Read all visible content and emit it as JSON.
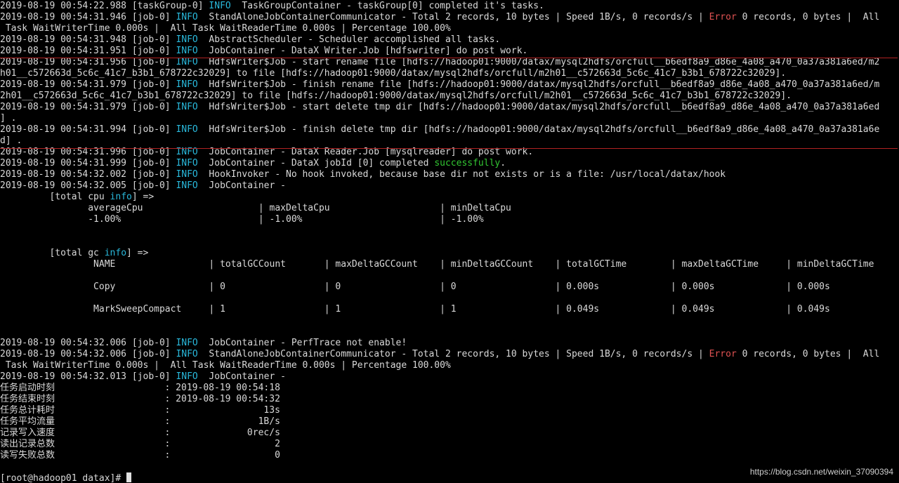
{
  "terminal": {
    "lines": [
      [
        {
          "t": "2019-08-19 00:54:22.988 [taskGroup-0] "
        },
        {
          "t": "INFO",
          "c": "info"
        },
        {
          "t": "  TaskGroupContainer - taskGroup[0] completed it's tasks."
        }
      ],
      [
        {
          "t": "2019-08-19 00:54:31.946 [job-0] "
        },
        {
          "t": "INFO",
          "c": "info"
        },
        {
          "t": "  StandAloneJobContainerCommunicator - Total 2 records, 10 bytes | Speed 1B/s, 0 records/s | "
        },
        {
          "t": "Error",
          "c": "error"
        },
        {
          "t": " 0 records, 0 bytes |  All"
        }
      ],
      [
        {
          "t": " Task WaitWriterTime 0.000s |  All Task WaitReaderTime 0.000s | Percentage 100.00%"
        }
      ],
      [
        {
          "t": "2019-08-19 00:54:31.948 [job-0] "
        },
        {
          "t": "INFO",
          "c": "info"
        },
        {
          "t": "  AbstractScheduler - Scheduler accomplished all tasks."
        }
      ],
      [
        {
          "t": "2019-08-19 00:54:31.951 [job-0] "
        },
        {
          "t": "INFO",
          "c": "info"
        },
        {
          "t": "  JobContainer - DataX Writer.Job [hdfswriter] do post work."
        }
      ],
      [
        {
          "t": "2019-08-19 00:54:31.956 [job-0] "
        },
        {
          "t": "INFO",
          "c": "info"
        },
        {
          "t": "  HdfsWriter$Job - start rename file [hdfs://hadoop01:9000/datax/mysql2hdfs/orcfull__b6edf8a9_d86e_4a08_a470_0a37a381a6ed/m2"
        }
      ],
      [
        {
          "t": "h01__c572663d_5c6c_41c7_b3b1_678722c32029] to file [hdfs://hadoop01:9000/datax/mysql2hdfs/orcfull/m2h01__c572663d_5c6c_41c7_b3b1_678722c32029]."
        }
      ],
      [
        {
          "t": "2019-08-19 00:54:31.979 [job-0] "
        },
        {
          "t": "INFO",
          "c": "info"
        },
        {
          "t": "  HdfsWriter$Job - finish rename file [hdfs://hadoop01:9000/datax/mysql2hdfs/orcfull__b6edf8a9_d86e_4a08_a470_0a37a381a6ed/m"
        }
      ],
      [
        {
          "t": "2h01__c572663d_5c6c_41c7_b3b1_678722c32029] to file [hdfs://hadoop01:9000/datax/mysql2hdfs/orcfull/m2h01__c572663d_5c6c_41c7_b3b1_678722c32029]."
        }
      ],
      [
        {
          "t": "2019-08-19 00:54:31.979 [job-0] "
        },
        {
          "t": "INFO",
          "c": "info"
        },
        {
          "t": "  HdfsWriter$Job - start delete tmp dir [hdfs://hadoop01:9000/datax/mysql2hdfs/orcfull__b6edf8a9_d86e_4a08_a470_0a37a381a6ed"
        }
      ],
      [
        {
          "t": "] ."
        }
      ],
      [
        {
          "t": "2019-08-19 00:54:31.994 [job-0] "
        },
        {
          "t": "INFO",
          "c": "info"
        },
        {
          "t": "  HdfsWriter$Job - finish delete tmp dir [hdfs://hadoop01:9000/datax/mysql2hdfs/orcfull__b6edf8a9_d86e_4a08_a470_0a37a381a6e"
        }
      ],
      [
        {
          "t": "d] ."
        }
      ],
      [
        {
          "t": "2019-08-19 00:54:31.996 [job-0] "
        },
        {
          "t": "INFO",
          "c": "info"
        },
        {
          "t": "  JobContainer - DataX Reader.Job [mysqlreader] do post work."
        }
      ],
      [
        {
          "t": "2019-08-19 00:54:31.999 [job-0] "
        },
        {
          "t": "INFO",
          "c": "info"
        },
        {
          "t": "  JobContainer - DataX jobId [0] completed "
        },
        {
          "t": "successfully",
          "c": "success"
        },
        {
          "t": "."
        }
      ],
      [
        {
          "t": "2019-08-19 00:54:32.002 [job-0] "
        },
        {
          "t": "INFO",
          "c": "info"
        },
        {
          "t": "  HookInvoker - No hook invoked, because base dir not exists or is a file: /usr/local/datax/hook"
        }
      ],
      [
        {
          "t": "2019-08-19 00:54:32.005 [job-0] "
        },
        {
          "t": "INFO",
          "c": "info"
        },
        {
          "t": "  JobContainer -"
        }
      ],
      [
        {
          "t": "         [total cpu "
        },
        {
          "t": "info",
          "c": "info"
        },
        {
          "t": "] =>"
        }
      ],
      [
        {
          "t": "                averageCpu                     | maxDeltaCpu                    | minDeltaCpu"
        }
      ],
      [
        {
          "t": "                -1.00%                         | -1.00%                         | -1.00%"
        }
      ],
      [
        {
          "t": ""
        }
      ],
      [
        {
          "t": ""
        }
      ],
      [
        {
          "t": "         [total gc "
        },
        {
          "t": "info",
          "c": "info"
        },
        {
          "t": "] =>"
        }
      ],
      [
        {
          "t": "                 NAME                 | totalGCCount       | maxDeltaGCCount    | minDeltaGCCount    | totalGCTime        | maxDeltaGCTime     | minDeltaGCTime"
        }
      ],
      [
        {
          "t": ""
        }
      ],
      [
        {
          "t": "                 Copy                 | 0                  | 0                  | 0                  | 0.000s             | 0.000s             | 0.000s"
        }
      ],
      [
        {
          "t": ""
        }
      ],
      [
        {
          "t": "                 MarkSweepCompact     | 1                  | 1                  | 1                  | 0.049s             | 0.049s             | 0.049s"
        }
      ],
      [
        {
          "t": ""
        }
      ],
      [
        {
          "t": ""
        }
      ],
      [
        {
          "t": "2019-08-19 00:54:32.006 [job-0] "
        },
        {
          "t": "INFO",
          "c": "info"
        },
        {
          "t": "  JobContainer - PerfTrace not enable!"
        }
      ],
      [
        {
          "t": "2019-08-19 00:54:32.006 [job-0] "
        },
        {
          "t": "INFO",
          "c": "info"
        },
        {
          "t": "  StandAloneJobContainerCommunicator - Total 2 records, 10 bytes | Speed 1B/s, 0 records/s | "
        },
        {
          "t": "Error",
          "c": "error"
        },
        {
          "t": " 0 records, 0 bytes |  All"
        }
      ],
      [
        {
          "t": " Task WaitWriterTime 0.000s |  All Task WaitReaderTime 0.000s | Percentage 100.00%"
        }
      ],
      [
        {
          "t": "2019-08-19 00:54:32.013 [job-0] "
        },
        {
          "t": "INFO",
          "c": "info"
        },
        {
          "t": "  JobContainer -"
        }
      ],
      [
        {
          "t": "任务启动时刻                    : 2019-08-19 00:54:18"
        }
      ],
      [
        {
          "t": "任务结束时刻                    : 2019-08-19 00:54:32"
        }
      ],
      [
        {
          "t": "任务总计耗时                    :                 13s"
        }
      ],
      [
        {
          "t": "任务平均流量                    :                1B/s"
        }
      ],
      [
        {
          "t": "记录写入速度                    :              0rec/s"
        }
      ],
      [
        {
          "t": "读出记录总数                    :                   2"
        }
      ],
      [
        {
          "t": "读写失败总数                    :                   0"
        }
      ],
      [
        {
          "t": ""
        }
      ]
    ],
    "prompt": "[root@hadoop01 datax]# ",
    "watermark": "https://blog.csdn.net/weixin_37090394"
  }
}
